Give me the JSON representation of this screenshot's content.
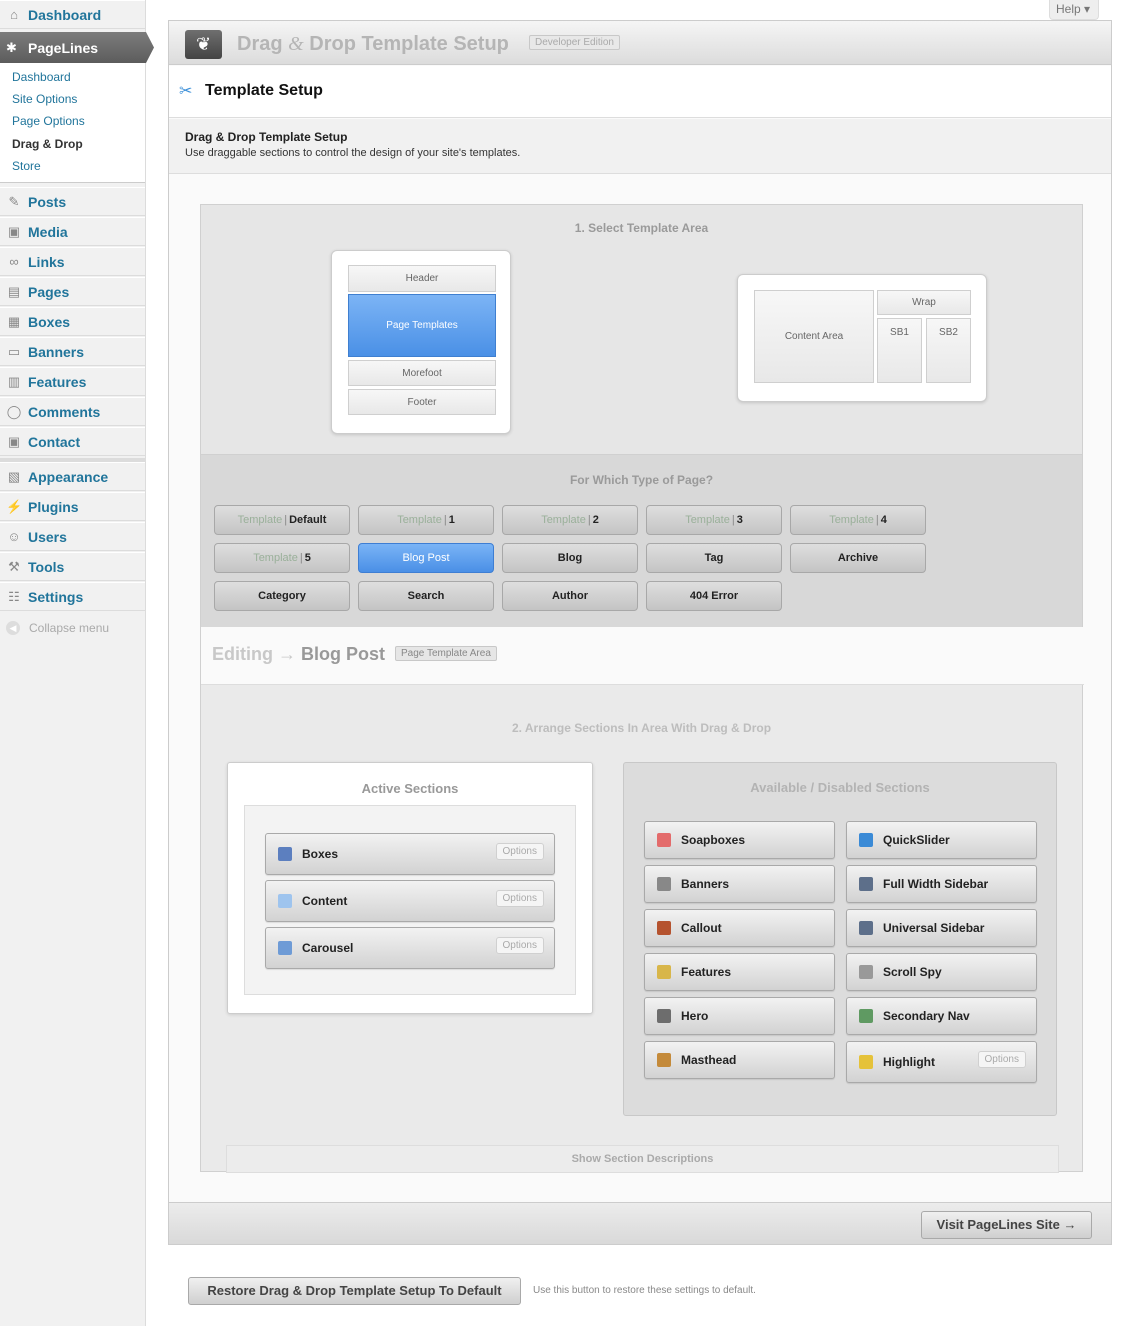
{
  "sidebar": {
    "dashboard": "Dashboard",
    "pagelines": "PageLines",
    "submenu": [
      "Dashboard",
      "Site Options",
      "Page Options",
      "Drag & Drop",
      "Store"
    ],
    "menu": [
      "Posts",
      "Media",
      "Links",
      "Pages",
      "Boxes",
      "Banners",
      "Features",
      "Comments",
      "Contact"
    ],
    "menu2": [
      "Appearance",
      "Plugins",
      "Users",
      "Tools",
      "Settings"
    ],
    "collapse": "Collapse menu"
  },
  "help": "Help ▾",
  "header": {
    "title_a": "Drag ",
    "title_amp": "&",
    "title_b": " Drop Template Setup",
    "badge": "Developer Edition"
  },
  "setup": {
    "title": "Template Setup",
    "desc_title": "Drag & Drop Template Setup",
    "desc_text": "Use draggable sections to control the design of your site's templates."
  },
  "area_select": {
    "title": "1. Select Template Area",
    "left": [
      "Header",
      "Page Templates",
      "Morefoot",
      "Footer"
    ],
    "right": {
      "content": "Content Area",
      "wrap": "Wrap",
      "sb1": "SB1",
      "sb2": "SB2"
    }
  },
  "page_types": {
    "title": "For Which Type of Page?",
    "template_word": "Template",
    "pipe": "|",
    "templates": [
      "Default",
      "1",
      "2",
      "3",
      "4",
      "5"
    ],
    "others": [
      "Blog Post",
      "Blog",
      "Tag",
      "Archive",
      "Category",
      "Search",
      "Author",
      "404 Error"
    ],
    "active": "Blog Post"
  },
  "editing": {
    "prefix": "Editing →",
    "target": "Blog Post",
    "badge": "Page Template Area",
    "arrange_title": "2. Arrange Sections In Area With Drag & Drop",
    "active_title": "Active Sections",
    "available_title": "Available / Disabled Sections",
    "options_label": "Options",
    "active_sections": [
      "Boxes",
      "Content",
      "Carousel"
    ],
    "available_left": [
      "Soapboxes",
      "Banners",
      "Callout",
      "Features",
      "Hero",
      "Masthead"
    ],
    "available_right": [
      "QuickSlider",
      "Full Width Sidebar",
      "Universal Sidebar",
      "Scroll Spy",
      "Secondary Nav",
      "Highlight"
    ],
    "show_desc": "Show Section Descriptions"
  },
  "visit_button": "Visit PageLines Site →",
  "restore_button": "Restore Drag & Drop Template Setup To Default",
  "restore_note": "Use this button to restore these settings to default."
}
